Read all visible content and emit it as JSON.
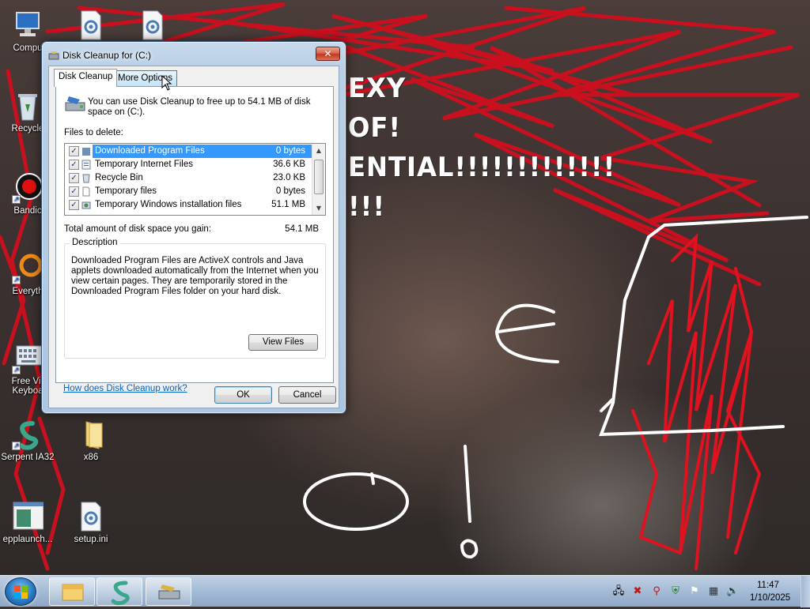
{
  "wallpaper": {
    "scrawl_lines": [
      "EXY",
      "OF!",
      "ENTIAL!!!!!!!!!!!!!",
      "!!!"
    ],
    "scrawl_colors": {
      "red": "#c8101e",
      "white": "#ffffff"
    }
  },
  "desktop_icons": [
    {
      "name": "computer",
      "label": "Compu"
    },
    {
      "name": "recycle-bin",
      "label": "Recycle"
    },
    {
      "name": "bandicam",
      "label": "Bandic"
    },
    {
      "name": "everything",
      "label": "Everyth"
    },
    {
      "name": "free-virtual-keyboard",
      "label": "Free Vir\nKeyboa"
    },
    {
      "name": "serpent",
      "label": "Serpent IA32"
    },
    {
      "name": "x86",
      "label": "x86"
    },
    {
      "name": "epplaunch",
      "label": "epplaunch..."
    },
    {
      "name": "setup-ini",
      "label": "setup.ini"
    }
  ],
  "dialog": {
    "title": "Disk Cleanup for  (C:)",
    "close_label": "✕",
    "tabs": [
      {
        "label": "Disk Cleanup",
        "active": true
      },
      {
        "label": "More Options",
        "active": false
      }
    ],
    "intro": "You can use Disk Cleanup to free up to 54.1 MB of disk space on  (C:).",
    "files_label": "Files to delete:",
    "files": [
      {
        "name": "Downloaded Program Files",
        "size": "0 bytes",
        "checked": true,
        "selected": true,
        "icon": "folder-icon"
      },
      {
        "name": "Temporary Internet Files",
        "size": "36.6 KB",
        "checked": true,
        "selected": false,
        "icon": "internet-files-icon"
      },
      {
        "name": "Recycle Bin",
        "size": "23.0 KB",
        "checked": true,
        "selected": false,
        "icon": "recycle-bin-icon"
      },
      {
        "name": "Temporary files",
        "size": "0 bytes",
        "checked": true,
        "selected": false,
        "icon": "blank-file-icon"
      },
      {
        "name": "Temporary Windows installation files",
        "size": "51.1 MB",
        "checked": true,
        "selected": false,
        "icon": "installer-icon"
      }
    ],
    "gain_label": "Total amount of disk space you gain:",
    "gain_value": "54.1 MB",
    "description_title": "Description",
    "description": "Downloaded Program Files are ActiveX controls and Java applets downloaded automatically from the Internet when you view certain pages. They are temporarily stored in the Downloaded Program Files folder on your hard disk.",
    "view_files_label": "View Files",
    "help_link": "How does Disk Cleanup work?",
    "ok_label": "OK",
    "cancel_label": "Cancel"
  },
  "taskbar": {
    "pinned": [
      "file-explorer",
      "serpent",
      "disk-cleanup"
    ],
    "tray_icons": [
      "network-green-icon",
      "network-x-icon",
      "search-red-icon",
      "security-icon",
      "flag-icon",
      "display-icon",
      "volume-icon"
    ],
    "clock_time": "11:47",
    "clock_date": "1/10/2025"
  },
  "colors": {
    "selection": "#3399ff",
    "link": "#0066cc",
    "close_button": "#c2371c",
    "taskbar": "#a9bfd9"
  }
}
